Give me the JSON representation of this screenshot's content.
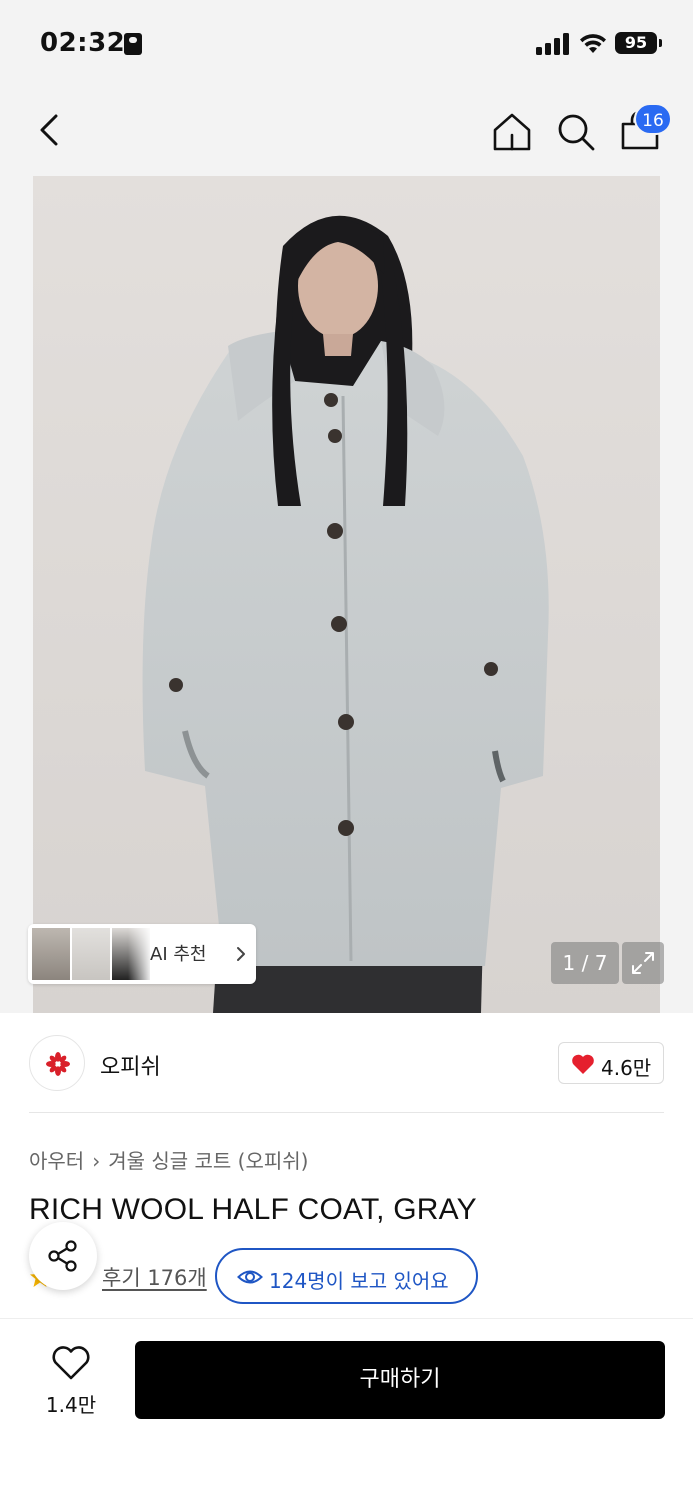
{
  "status_bar": {
    "time": "02:32",
    "battery": "95"
  },
  "nav": {
    "cart_count": "16"
  },
  "gallery": {
    "ai_label": "AI 추천",
    "page_indicator": "1 / 7"
  },
  "brand": {
    "name": "오피쉬",
    "likes": "4.6만"
  },
  "breadcrumb": {
    "category": "아우터",
    "subcategory": "겨울 싱글 코트 (오피쉬)"
  },
  "product": {
    "title": "RICH WOOL HALF COAT, GRAY"
  },
  "reviews": {
    "link_label": "후기 176개",
    "viewers": "124명이 보고 있어요"
  },
  "bottom_bar": {
    "wish_count": "1.4만",
    "buy_label": "구매하기"
  },
  "colors": {
    "accent_blue": "#2a6af2",
    "viewers_blue": "#1f56c4",
    "heart_red": "#e5202e",
    "brand_red": "#d9202a",
    "buy_button": "#000000"
  },
  "icons": [
    "back-icon",
    "home-icon",
    "search-icon",
    "cart-icon",
    "chevron-right-icon",
    "expand-icon",
    "heart-icon",
    "share-icon",
    "eye-icon",
    "star-icon"
  ]
}
